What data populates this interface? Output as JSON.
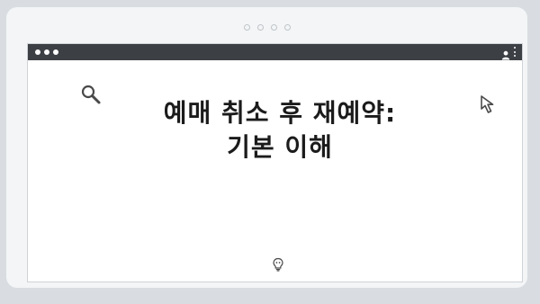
{
  "window": {
    "controls": [
      "dot",
      "dot",
      "dot"
    ],
    "icons": [
      "profile-icon",
      "menu-icon"
    ]
  },
  "page": {
    "headline": "예매 취소 후 재예약: 기본 이해",
    "icons": [
      "search-icon",
      "cursor-icon",
      "lightbulb-icon"
    ]
  },
  "colors": {
    "background": "#d9dde1",
    "card": "#f3f5f6",
    "titlebar": "#3c3f44",
    "browser_body": "#ffffff",
    "text": "#1b1b1b"
  }
}
